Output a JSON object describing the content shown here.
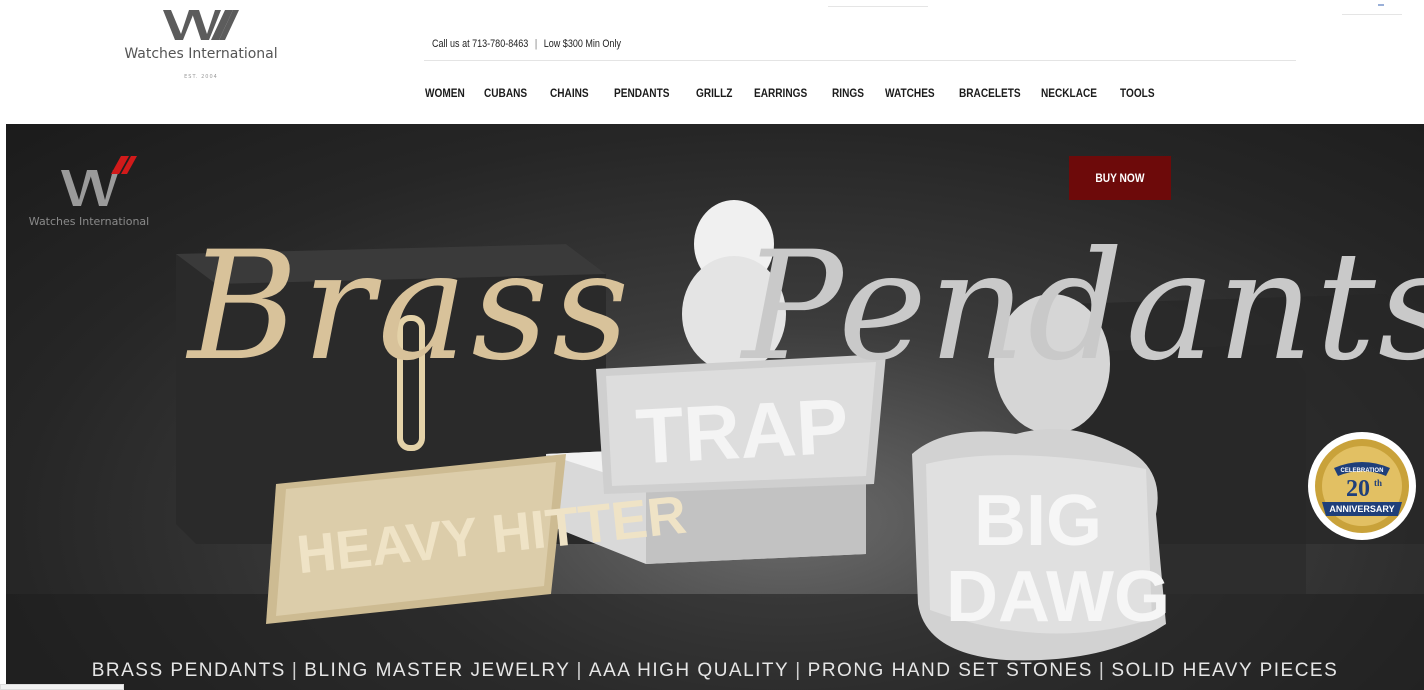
{
  "header": {
    "logo_monogram": "WI",
    "logo_brand": "Watches International",
    "logo_est": "EST. 2004",
    "call_text": "Call us at 713-780-8463",
    "separator": "|",
    "min_order_text": "Low $300 Min Only"
  },
  "nav": {
    "items": [
      "WOMEN",
      "CUBANS",
      "CHAINS",
      "PENDANTS",
      "GRILLZ",
      "EARRINGS",
      "RINGS",
      "WATCHES",
      "BRACELETS",
      "NECKLACE",
      "TOOLS"
    ]
  },
  "hero": {
    "watermark_brand": "Watches International",
    "script_left": "Brass",
    "script_right": "Pendants",
    "buy_button": "BUY NOW",
    "pendants": [
      "HEAVY HITTER",
      "TRAP",
      "BIG",
      "DAWG"
    ],
    "badge_top": "CELEBRATION",
    "badge_number": "20",
    "badge_suffix": "th",
    "badge_bottom": "ANNIVERSARY",
    "tagline": [
      "BRASS PENDANTS",
      "BLING MASTER JEWELRY",
      "AAA HIGH QUALITY",
      "PRONG HAND SET STONES",
      "SOLID HEAVY PIECES"
    ]
  },
  "colors": {
    "buy_button_bg": "#6d0a0a",
    "script_gold": "#d8c29a",
    "badge_gold": "#c9a23a",
    "badge_blue": "#1f3f7a"
  }
}
